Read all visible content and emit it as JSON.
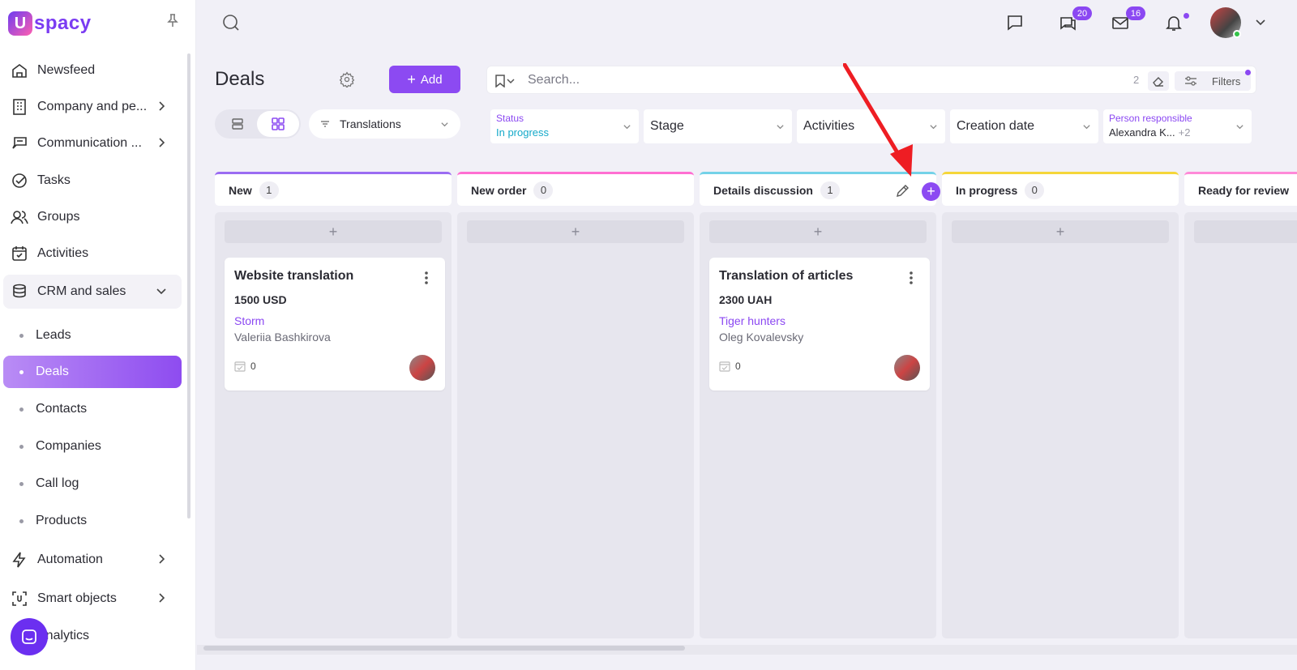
{
  "brand": {
    "logo_letter": "U",
    "logo_text": "spacy"
  },
  "sidebar": {
    "items": [
      {
        "label": "Newsfeed",
        "icon": "home-icon"
      },
      {
        "label": "Company and pe...",
        "icon": "building-icon"
      },
      {
        "label": "Communication ...",
        "icon": "chat-icon"
      },
      {
        "label": "Tasks",
        "icon": "check-circle-icon"
      },
      {
        "label": "Groups",
        "icon": "users-icon"
      },
      {
        "label": "Activities",
        "icon": "calendar-icon"
      },
      {
        "label": "CRM and sales",
        "icon": "database-icon"
      }
    ],
    "crm_sub": [
      "Leads",
      "Deals",
      "Contacts",
      "Companies",
      "Call log",
      "Products"
    ],
    "bottom_items": [
      {
        "label": "Automation",
        "icon": "lightning-icon"
      },
      {
        "label": "Smart objects",
        "icon": "smart-object-icon"
      },
      {
        "label": "Analytics",
        "icon": "chart-icon"
      }
    ]
  },
  "header": {
    "chat_badge": "20",
    "mail_badge": "16"
  },
  "page": {
    "title": "Deals",
    "add_label": "Add"
  },
  "search": {
    "placeholder": "Search...",
    "count": "2",
    "filters_label": "Filters"
  },
  "pipeline": {
    "selected": "Translations"
  },
  "filters": {
    "status": {
      "label": "Status",
      "value": "In progress"
    },
    "stage": "Stage",
    "activities": "Activities",
    "creation_date": "Creation date",
    "person": {
      "label": "Person responsible",
      "value": "Alexandra K...",
      "extra": "+2"
    }
  },
  "columns": [
    {
      "name": "New",
      "count": "1",
      "color": "#9b6cf2"
    },
    {
      "name": "New order",
      "count": "0",
      "color": "#ff6fd2"
    },
    {
      "name": "Details discussion",
      "count": "1",
      "color": "#74d2e8"
    },
    {
      "name": "In progress",
      "count": "0",
      "color": "#f5d63a"
    },
    {
      "name": "Ready for review",
      "count": "",
      "color": "#ff8ad8"
    }
  ],
  "cards": [
    {
      "title": "Website translation",
      "amount": "1500 USD",
      "company": "Storm",
      "person": "Valeriia Bashkirova",
      "activities": "0"
    },
    {
      "title": "Translation of articles",
      "amount": "2300 UAH",
      "company": "Tiger hunters",
      "person": "Oleg Kovalevsky",
      "activities": "0"
    }
  ],
  "colors": {
    "accent": "#8c4af2",
    "annotation_arrow": "#ee1d23"
  }
}
